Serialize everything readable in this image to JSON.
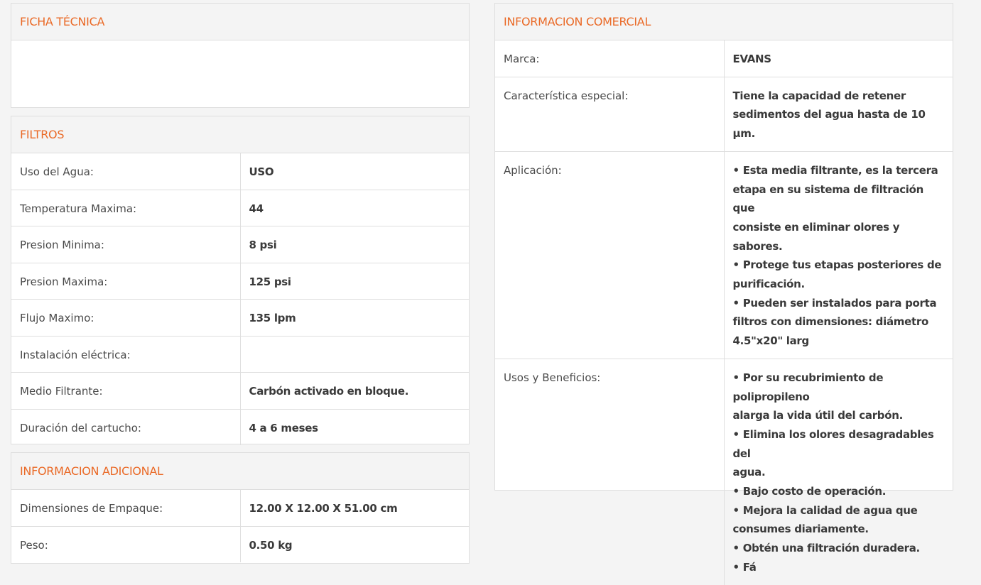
{
  "ficha_tecnica": {
    "title": "FICHA TÉCNICA"
  },
  "filtros": {
    "title": "FILTROS",
    "rows": [
      {
        "label": "Uso del Agua:",
        "value": "USO"
      },
      {
        "label": "Temperatura Maxima:",
        "value": "44"
      },
      {
        "label": "Presion Minima:",
        "value": "8 psi"
      },
      {
        "label": "Presion Maxima:",
        "value": "125 psi"
      },
      {
        "label": "Flujo Maximo:",
        "value": "135 lpm"
      },
      {
        "label": "Instalación eléctrica:",
        "value": ""
      },
      {
        "label": "Medio Filtrante:",
        "value": "Carbón activado en bloque."
      },
      {
        "label": "Duración del cartucho:",
        "value": "4 a 6 meses"
      }
    ]
  },
  "informacion_adicional": {
    "title": "INFORMACION ADICIONAL",
    "rows": [
      {
        "label": "Dimensiones de Empaque:",
        "value": "12.00 X 12.00 X 51.00 cm"
      },
      {
        "label": "Peso:",
        "value": "0.50 kg"
      }
    ]
  },
  "informacion_comercial": {
    "title": "INFORMACION COMERCIAL",
    "rows": [
      {
        "label": "Marca:",
        "lines": [
          "EVANS"
        ]
      },
      {
        "label": "Característica especial:",
        "lines": [
          "Tiene la capacidad de retener",
          "sedimentos del agua hasta de 10 μm."
        ]
      },
      {
        "label": "Aplicación:",
        "lines": [
          "• Esta media filtrante, es la tercera",
          "etapa en su sistema de filtración que",
          "consiste en eliminar olores y sabores.",
          "• Protege tus etapas posteriores de",
          "purificación.",
          "• Pueden ser instalados para porta",
          "filtros con dimensiones: diámetro",
          "4.5\"x20\" larg"
        ]
      },
      {
        "label": "Usos y Beneficios:",
        "lines": [
          "• Por su recubrimiento de polipropileno",
          "alarga la vida útil del carbón.",
          "• Elimina los olores desagradables del",
          "agua.",
          "• Bajo costo de operación.",
          "• Mejora la calidad de agua que",
          "consumes diariamente.",
          "• Obtén una filtración duradera.",
          "• Fá"
        ]
      }
    ]
  },
  "colors": {
    "accent": "#ea6a27",
    "background": "#f4f4f4",
    "border": "#dedede"
  }
}
